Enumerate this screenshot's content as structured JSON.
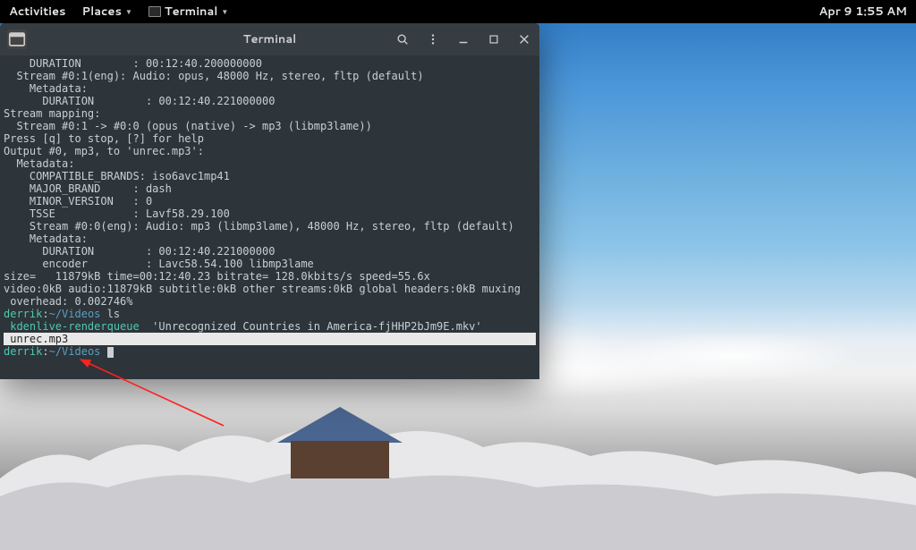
{
  "topbar": {
    "activities": "Activities",
    "places": "Places",
    "terminal": "Terminal",
    "datetime": "Apr 9  1:55 AM"
  },
  "window": {
    "title": "Terminal"
  },
  "terminal": {
    "lines": [
      "    DURATION        : 00:12:40.200000000",
      "  Stream #0:1(eng): Audio: opus, 48000 Hz, stereo, fltp (default)",
      "    Metadata:",
      "      DURATION        : 00:12:40.221000000",
      "Stream mapping:",
      "  Stream #0:1 -> #0:0 (opus (native) -> mp3 (libmp3lame))",
      "Press [q] to stop, [?] for help",
      "Output #0, mp3, to 'unrec.mp3':",
      "  Metadata:",
      "    COMPATIBLE_BRANDS: iso6avc1mp41",
      "    MAJOR_BRAND     : dash",
      "    MINOR_VERSION   : 0",
      "    TSSE            : Lavf58.29.100",
      "    Stream #0:0(eng): Audio: mp3 (libmp3lame), 48000 Hz, stereo, fltp (default)",
      "    Metadata:",
      "      DURATION        : 00:12:40.221000000",
      "      encoder         : Lavc58.54.100 libmp3lame",
      "size=   11879kB time=00:12:40.23 bitrate= 128.0kbits/s speed=55.6x",
      "video:0kB audio:11879kB subtitle:0kB other streams:0kB global headers:0kB muxing",
      " overhead: 0.002746%"
    ],
    "prompt1": {
      "user": "derrik",
      "sep": ":",
      "path": "~/Videos",
      "cmd": " ls"
    },
    "ls_line": {
      "kden": " kdenlive-renderqueue",
      "rest": "  'Unrecognized Countries in America-fjHHP2bJm9E.mkv'"
    },
    "highlighted": " unrec.mp3",
    "prompt2": {
      "user": "derrik",
      "sep": ":",
      "path": "~/Videos",
      "cmd": " "
    }
  }
}
